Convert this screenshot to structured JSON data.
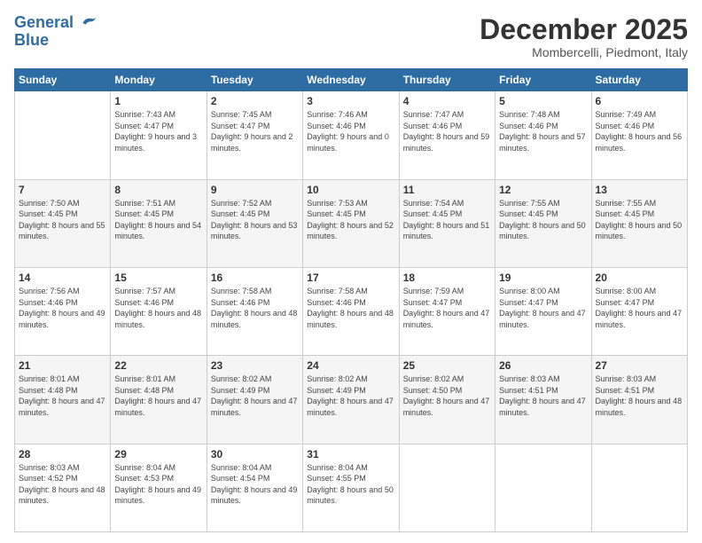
{
  "header": {
    "logo_line1": "General",
    "logo_line2": "Blue",
    "month": "December 2025",
    "location": "Mombercelli, Piedmont, Italy"
  },
  "days_of_week": [
    "Sunday",
    "Monday",
    "Tuesday",
    "Wednesday",
    "Thursday",
    "Friday",
    "Saturday"
  ],
  "weeks": [
    [
      {
        "day": "",
        "sunrise": "",
        "sunset": "",
        "daylight": ""
      },
      {
        "day": "1",
        "sunrise": "7:43 AM",
        "sunset": "4:47 PM",
        "daylight": "9 hours and 3 minutes."
      },
      {
        "day": "2",
        "sunrise": "7:45 AM",
        "sunset": "4:47 PM",
        "daylight": "9 hours and 2 minutes."
      },
      {
        "day": "3",
        "sunrise": "7:46 AM",
        "sunset": "4:46 PM",
        "daylight": "9 hours and 0 minutes."
      },
      {
        "day": "4",
        "sunrise": "7:47 AM",
        "sunset": "4:46 PM",
        "daylight": "8 hours and 59 minutes."
      },
      {
        "day": "5",
        "sunrise": "7:48 AM",
        "sunset": "4:46 PM",
        "daylight": "8 hours and 57 minutes."
      },
      {
        "day": "6",
        "sunrise": "7:49 AM",
        "sunset": "4:46 PM",
        "daylight": "8 hours and 56 minutes."
      }
    ],
    [
      {
        "day": "7",
        "sunrise": "7:50 AM",
        "sunset": "4:45 PM",
        "daylight": "8 hours and 55 minutes."
      },
      {
        "day": "8",
        "sunrise": "7:51 AM",
        "sunset": "4:45 PM",
        "daylight": "8 hours and 54 minutes."
      },
      {
        "day": "9",
        "sunrise": "7:52 AM",
        "sunset": "4:45 PM",
        "daylight": "8 hours and 53 minutes."
      },
      {
        "day": "10",
        "sunrise": "7:53 AM",
        "sunset": "4:45 PM",
        "daylight": "8 hours and 52 minutes."
      },
      {
        "day": "11",
        "sunrise": "7:54 AM",
        "sunset": "4:45 PM",
        "daylight": "8 hours and 51 minutes."
      },
      {
        "day": "12",
        "sunrise": "7:55 AM",
        "sunset": "4:45 PM",
        "daylight": "8 hours and 50 minutes."
      },
      {
        "day": "13",
        "sunrise": "7:55 AM",
        "sunset": "4:45 PM",
        "daylight": "8 hours and 50 minutes."
      }
    ],
    [
      {
        "day": "14",
        "sunrise": "7:56 AM",
        "sunset": "4:46 PM",
        "daylight": "8 hours and 49 minutes."
      },
      {
        "day": "15",
        "sunrise": "7:57 AM",
        "sunset": "4:46 PM",
        "daylight": "8 hours and 48 minutes."
      },
      {
        "day": "16",
        "sunrise": "7:58 AM",
        "sunset": "4:46 PM",
        "daylight": "8 hours and 48 minutes."
      },
      {
        "day": "17",
        "sunrise": "7:58 AM",
        "sunset": "4:46 PM",
        "daylight": "8 hours and 48 minutes."
      },
      {
        "day": "18",
        "sunrise": "7:59 AM",
        "sunset": "4:47 PM",
        "daylight": "8 hours and 47 minutes."
      },
      {
        "day": "19",
        "sunrise": "8:00 AM",
        "sunset": "4:47 PM",
        "daylight": "8 hours and 47 minutes."
      },
      {
        "day": "20",
        "sunrise": "8:00 AM",
        "sunset": "4:47 PM",
        "daylight": "8 hours and 47 minutes."
      }
    ],
    [
      {
        "day": "21",
        "sunrise": "8:01 AM",
        "sunset": "4:48 PM",
        "daylight": "8 hours and 47 minutes."
      },
      {
        "day": "22",
        "sunrise": "8:01 AM",
        "sunset": "4:48 PM",
        "daylight": "8 hours and 47 minutes."
      },
      {
        "day": "23",
        "sunrise": "8:02 AM",
        "sunset": "4:49 PM",
        "daylight": "8 hours and 47 minutes."
      },
      {
        "day": "24",
        "sunrise": "8:02 AM",
        "sunset": "4:49 PM",
        "daylight": "8 hours and 47 minutes."
      },
      {
        "day": "25",
        "sunrise": "8:02 AM",
        "sunset": "4:50 PM",
        "daylight": "8 hours and 47 minutes."
      },
      {
        "day": "26",
        "sunrise": "8:03 AM",
        "sunset": "4:51 PM",
        "daylight": "8 hours and 47 minutes."
      },
      {
        "day": "27",
        "sunrise": "8:03 AM",
        "sunset": "4:51 PM",
        "daylight": "8 hours and 48 minutes."
      }
    ],
    [
      {
        "day": "28",
        "sunrise": "8:03 AM",
        "sunset": "4:52 PM",
        "daylight": "8 hours and 48 minutes."
      },
      {
        "day": "29",
        "sunrise": "8:04 AM",
        "sunset": "4:53 PM",
        "daylight": "8 hours and 49 minutes."
      },
      {
        "day": "30",
        "sunrise": "8:04 AM",
        "sunset": "4:54 PM",
        "daylight": "8 hours and 49 minutes."
      },
      {
        "day": "31",
        "sunrise": "8:04 AM",
        "sunset": "4:55 PM",
        "daylight": "8 hours and 50 minutes."
      },
      {
        "day": "",
        "sunrise": "",
        "sunset": "",
        "daylight": ""
      },
      {
        "day": "",
        "sunrise": "",
        "sunset": "",
        "daylight": ""
      },
      {
        "day": "",
        "sunrise": "",
        "sunset": "",
        "daylight": ""
      }
    ]
  ]
}
